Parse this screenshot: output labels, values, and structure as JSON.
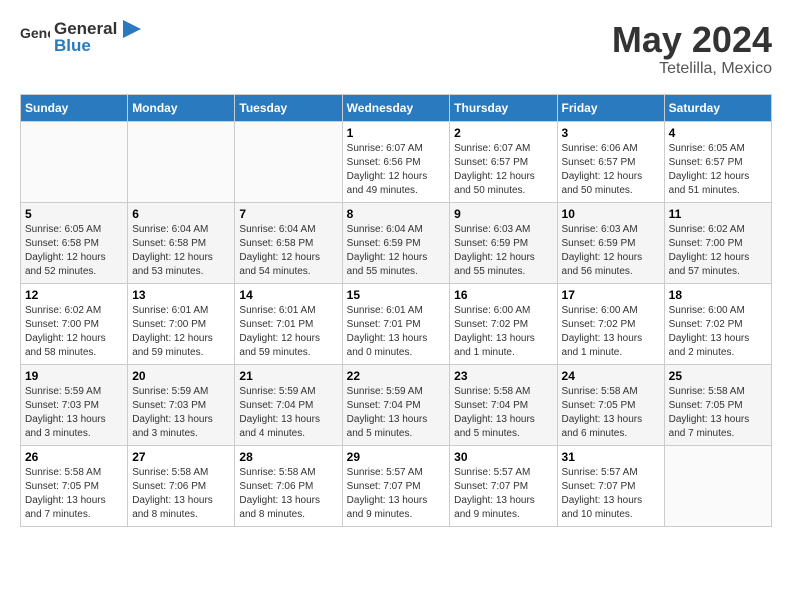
{
  "header": {
    "logo_general": "General",
    "logo_blue": "Blue",
    "month_year": "May 2024",
    "location": "Tetelilla, Mexico"
  },
  "calendar": {
    "days_of_week": [
      "Sunday",
      "Monday",
      "Tuesday",
      "Wednesday",
      "Thursday",
      "Friday",
      "Saturday"
    ],
    "weeks": [
      [
        {
          "day": "",
          "info": ""
        },
        {
          "day": "",
          "info": ""
        },
        {
          "day": "",
          "info": ""
        },
        {
          "day": "1",
          "info": "Sunrise: 6:07 AM\nSunset: 6:56 PM\nDaylight: 12 hours\nand 49 minutes."
        },
        {
          "day": "2",
          "info": "Sunrise: 6:07 AM\nSunset: 6:57 PM\nDaylight: 12 hours\nand 50 minutes."
        },
        {
          "day": "3",
          "info": "Sunrise: 6:06 AM\nSunset: 6:57 PM\nDaylight: 12 hours\nand 50 minutes."
        },
        {
          "day": "4",
          "info": "Sunrise: 6:05 AM\nSunset: 6:57 PM\nDaylight: 12 hours\nand 51 minutes."
        }
      ],
      [
        {
          "day": "5",
          "info": "Sunrise: 6:05 AM\nSunset: 6:58 PM\nDaylight: 12 hours\nand 52 minutes."
        },
        {
          "day": "6",
          "info": "Sunrise: 6:04 AM\nSunset: 6:58 PM\nDaylight: 12 hours\nand 53 minutes."
        },
        {
          "day": "7",
          "info": "Sunrise: 6:04 AM\nSunset: 6:58 PM\nDaylight: 12 hours\nand 54 minutes."
        },
        {
          "day": "8",
          "info": "Sunrise: 6:04 AM\nSunset: 6:59 PM\nDaylight: 12 hours\nand 55 minutes."
        },
        {
          "day": "9",
          "info": "Sunrise: 6:03 AM\nSunset: 6:59 PM\nDaylight: 12 hours\nand 55 minutes."
        },
        {
          "day": "10",
          "info": "Sunrise: 6:03 AM\nSunset: 6:59 PM\nDaylight: 12 hours\nand 56 minutes."
        },
        {
          "day": "11",
          "info": "Sunrise: 6:02 AM\nSunset: 7:00 PM\nDaylight: 12 hours\nand 57 minutes."
        }
      ],
      [
        {
          "day": "12",
          "info": "Sunrise: 6:02 AM\nSunset: 7:00 PM\nDaylight: 12 hours\nand 58 minutes."
        },
        {
          "day": "13",
          "info": "Sunrise: 6:01 AM\nSunset: 7:00 PM\nDaylight: 12 hours\nand 59 minutes."
        },
        {
          "day": "14",
          "info": "Sunrise: 6:01 AM\nSunset: 7:01 PM\nDaylight: 12 hours\nand 59 minutes."
        },
        {
          "day": "15",
          "info": "Sunrise: 6:01 AM\nSunset: 7:01 PM\nDaylight: 13 hours\nand 0 minutes."
        },
        {
          "day": "16",
          "info": "Sunrise: 6:00 AM\nSunset: 7:02 PM\nDaylight: 13 hours\nand 1 minute."
        },
        {
          "day": "17",
          "info": "Sunrise: 6:00 AM\nSunset: 7:02 PM\nDaylight: 13 hours\nand 1 minute."
        },
        {
          "day": "18",
          "info": "Sunrise: 6:00 AM\nSunset: 7:02 PM\nDaylight: 13 hours\nand 2 minutes."
        }
      ],
      [
        {
          "day": "19",
          "info": "Sunrise: 5:59 AM\nSunset: 7:03 PM\nDaylight: 13 hours\nand 3 minutes."
        },
        {
          "day": "20",
          "info": "Sunrise: 5:59 AM\nSunset: 7:03 PM\nDaylight: 13 hours\nand 3 minutes."
        },
        {
          "day": "21",
          "info": "Sunrise: 5:59 AM\nSunset: 7:04 PM\nDaylight: 13 hours\nand 4 minutes."
        },
        {
          "day": "22",
          "info": "Sunrise: 5:59 AM\nSunset: 7:04 PM\nDaylight: 13 hours\nand 5 minutes."
        },
        {
          "day": "23",
          "info": "Sunrise: 5:58 AM\nSunset: 7:04 PM\nDaylight: 13 hours\nand 5 minutes."
        },
        {
          "day": "24",
          "info": "Sunrise: 5:58 AM\nSunset: 7:05 PM\nDaylight: 13 hours\nand 6 minutes."
        },
        {
          "day": "25",
          "info": "Sunrise: 5:58 AM\nSunset: 7:05 PM\nDaylight: 13 hours\nand 7 minutes."
        }
      ],
      [
        {
          "day": "26",
          "info": "Sunrise: 5:58 AM\nSunset: 7:05 PM\nDaylight: 13 hours\nand 7 minutes."
        },
        {
          "day": "27",
          "info": "Sunrise: 5:58 AM\nSunset: 7:06 PM\nDaylight: 13 hours\nand 8 minutes."
        },
        {
          "day": "28",
          "info": "Sunrise: 5:58 AM\nSunset: 7:06 PM\nDaylight: 13 hours\nand 8 minutes."
        },
        {
          "day": "29",
          "info": "Sunrise: 5:57 AM\nSunset: 7:07 PM\nDaylight: 13 hours\nand 9 minutes."
        },
        {
          "day": "30",
          "info": "Sunrise: 5:57 AM\nSunset: 7:07 PM\nDaylight: 13 hours\nand 9 minutes."
        },
        {
          "day": "31",
          "info": "Sunrise: 5:57 AM\nSunset: 7:07 PM\nDaylight: 13 hours\nand 10 minutes."
        },
        {
          "day": "",
          "info": ""
        }
      ]
    ]
  }
}
